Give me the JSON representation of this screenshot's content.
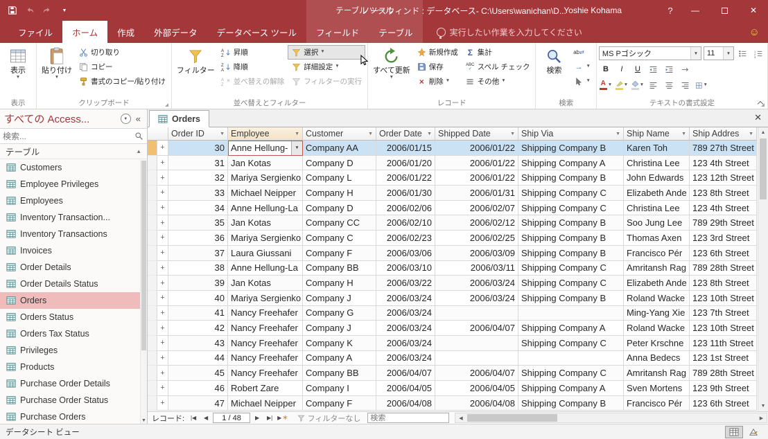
{
  "colors": {
    "brand": "#A4373A",
    "row_selection": "#CBE2F5",
    "sidebar_selection": "#F0BCBB",
    "current_record_selector": "#F2BF71"
  },
  "titlebar": {
    "contextual_title": "テーブル ツール",
    "window_title": "ノースウィンド : データベース- C:\\Users\\wanichan\\D...",
    "user_name": "Yoshie Kohama",
    "help_label": "?"
  },
  "ribbon": {
    "file_tab": "ファイル",
    "tabs": [
      {
        "label": "ホーム",
        "active": true
      },
      {
        "label": "作成",
        "active": false
      },
      {
        "label": "外部データ",
        "active": false
      },
      {
        "label": "データベース ツール",
        "active": false
      }
    ],
    "contextual_tabs": [
      {
        "label": "フィールド"
      },
      {
        "label": "テーブル"
      }
    ],
    "tell_me": "実行したい作業を入力してください",
    "views": {
      "group_label": "表示",
      "view": "表示"
    },
    "clipboard": {
      "group_label": "クリップボード",
      "paste": "貼り付け",
      "cut": "切り取り",
      "copy": "コピー",
      "format_painter": "書式のコピー/貼り付け"
    },
    "sort_filter": {
      "group_label": "並べ替えとフィルター",
      "filter": "フィルター",
      "ascending": "昇順",
      "descending": "降順",
      "clear_sort": "並べ替えの解除",
      "selection": "選択",
      "advanced": "詳細設定",
      "toggle_filter": "フィルターの実行"
    },
    "records": {
      "group_label": "レコード",
      "refresh_all": "すべて更新",
      "new": "新規作成",
      "save": "保存",
      "delete": "削除",
      "totals": "集計",
      "spelling": "スペル チェック",
      "more": "その他"
    },
    "find": {
      "group_label": "検索",
      "find": "検索"
    },
    "text_formatting": {
      "group_label": "テキストの書式設定",
      "font_name": "MS Pゴシック",
      "font_size": "11",
      "bold_label": "B",
      "italic_label": "I",
      "underline_label": "U",
      "font_color_label": "A"
    }
  },
  "sidebar": {
    "title": "すべての Access...",
    "search_placeholder": "検索...",
    "section_label": "テーブル",
    "selected_item": "Orders",
    "items": [
      "Customers",
      "Employee Privileges",
      "Employees",
      "Inventory Transaction...",
      "Inventory Transactions",
      "Invoices",
      "Order Details",
      "Order Details Status",
      "Orders",
      "Orders Status",
      "Orders Tax Status",
      "Privileges",
      "Products",
      "Purchase Order Details",
      "Purchase Order Status",
      "Purchase Orders"
    ]
  },
  "document": {
    "tab_label": "Orders",
    "active_column_index": 1,
    "columns": [
      "Order ID",
      "Employee",
      "Customer",
      "Order Date",
      "Shipped Date",
      "Ship Via",
      "Ship Name",
      "Ship Addres"
    ],
    "rows": [
      {
        "cells": [
          "30",
          "Anne Hellung-",
          "Company AA",
          "2006/01/15",
          "2006/01/22",
          "Shipping Company B",
          "Karen Toh",
          "789 27th Street"
        ],
        "selected": true,
        "editing_employee": true
      },
      {
        "cells": [
          "31",
          "Jan Kotas",
          "Company D",
          "2006/01/20",
          "2006/01/22",
          "Shipping Company A",
          "Christina Lee",
          "123 4th Street"
        ]
      },
      {
        "cells": [
          "32",
          "Mariya Sergienko",
          "Company L",
          "2006/01/22",
          "2006/01/22",
          "Shipping Company B",
          "John Edwards",
          "123 12th Street"
        ]
      },
      {
        "cells": [
          "33",
          "Michael Neipper",
          "Company H",
          "2006/01/30",
          "2006/01/31",
          "Shipping Company C",
          "Elizabeth Ande",
          "123 8th Street"
        ]
      },
      {
        "cells": [
          "34",
          "Anne Hellung-La",
          "Company D",
          "2006/02/06",
          "2006/02/07",
          "Shipping Company C",
          "Christina Lee",
          "123 4th Street"
        ]
      },
      {
        "cells": [
          "35",
          "Jan Kotas",
          "Company CC",
          "2006/02/10",
          "2006/02/12",
          "Shipping Company B",
          "Soo Jung Lee",
          "789 29th Street"
        ]
      },
      {
        "cells": [
          "36",
          "Mariya Sergienko",
          "Company C",
          "2006/02/23",
          "2006/02/25",
          "Shipping Company B",
          "Thomas Axen",
          "123 3rd Street"
        ]
      },
      {
        "cells": [
          "37",
          "Laura Giussani",
          "Company F",
          "2006/03/06",
          "2006/03/09",
          "Shipping Company B",
          "Francisco Pér",
          "123 6th Street"
        ]
      },
      {
        "cells": [
          "38",
          "Anne Hellung-La",
          "Company BB",
          "2006/03/10",
          "2006/03/11",
          "Shipping Company C",
          "Amritansh Rag",
          "789 28th Street"
        ]
      },
      {
        "cells": [
          "39",
          "Jan Kotas",
          "Company H",
          "2006/03/22",
          "2006/03/24",
          "Shipping Company C",
          "Elizabeth Ande",
          "123 8th Street"
        ]
      },
      {
        "cells": [
          "40",
          "Mariya Sergienko",
          "Company J",
          "2006/03/24",
          "2006/03/24",
          "Shipping Company B",
          "Roland Wacke",
          "123 10th Street"
        ]
      },
      {
        "cells": [
          "41",
          "Nancy Freehafer",
          "Company G",
          "2006/03/24",
          "",
          "",
          "Ming-Yang Xie",
          "123 7th Street"
        ]
      },
      {
        "cells": [
          "42",
          "Nancy Freehafer",
          "Company J",
          "2006/03/24",
          "2006/04/07",
          "Shipping Company A",
          "Roland Wacke",
          "123 10th Street"
        ]
      },
      {
        "cells": [
          "43",
          "Nancy Freehafer",
          "Company K",
          "2006/03/24",
          "",
          "Shipping Company C",
          "Peter Krschne",
          "123 11th Street"
        ]
      },
      {
        "cells": [
          "44",
          "Nancy Freehafer",
          "Company A",
          "2006/03/24",
          "",
          "",
          "Anna Bedecs",
          "123 1st Street"
        ]
      },
      {
        "cells": [
          "45",
          "Nancy Freehafer",
          "Company BB",
          "2006/04/07",
          "2006/04/07",
          "Shipping Company C",
          "Amritansh Rag",
          "789 28th Street"
        ]
      },
      {
        "cells": [
          "46",
          "Robert Zare",
          "Company I",
          "2006/04/05",
          "2006/04/05",
          "Shipping Company A",
          "Sven Mortens",
          "123 9th Street"
        ]
      },
      {
        "cells": [
          "47",
          "Michael Neipper",
          "Company F",
          "2006/04/08",
          "2006/04/08",
          "Shipping Company B",
          "Francisco Pér",
          "123 6th Street"
        ]
      }
    ]
  },
  "record_nav": {
    "label": "レコード:",
    "position": "1 / 48",
    "filter_status": "フィルターなし",
    "search_placeholder": "検索"
  },
  "status_bar": {
    "view_name": "データシート ビュー"
  }
}
